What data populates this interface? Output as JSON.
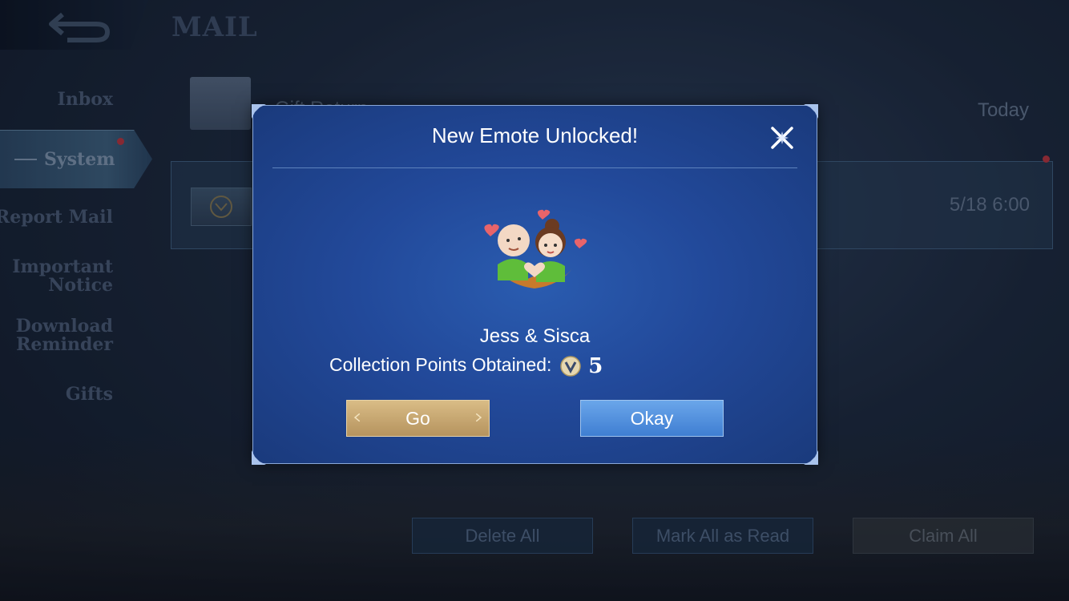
{
  "header": {
    "title": "MAIL"
  },
  "sidebar": {
    "items": [
      {
        "label": "Inbox"
      },
      {
        "label": "System",
        "active": true
      },
      {
        "label": "Report Mail"
      },
      {
        "label": "Important Notice"
      },
      {
        "label": "Download Reminder"
      },
      {
        "label": "Gifts"
      }
    ]
  },
  "mail_list": {
    "rows": [
      {
        "title": "Gift Return ...",
        "time": "Today"
      },
      {
        "title": "",
        "time": "5/18 6:00"
      }
    ]
  },
  "footer": {
    "delete_all": "Delete All",
    "mark_all_read": "Mark All as Read",
    "claim_all": "Claim All"
  },
  "modal": {
    "title": "New Emote Unlocked!",
    "emote_name": "Jess & Sisca",
    "collection_label": "Collection Points Obtained:",
    "collection_value": "5",
    "go_label": "Go",
    "okay_label": "Okay"
  },
  "colors": {
    "modal_bg": "#22499a",
    "go_button": "#c9a770",
    "okay_button": "#5592de",
    "notification_dot": "#b0303a"
  },
  "icons": [
    "back-arrow-icon",
    "envelope-icon",
    "close-icon",
    "collection-point-icon",
    "emote-image"
  ]
}
